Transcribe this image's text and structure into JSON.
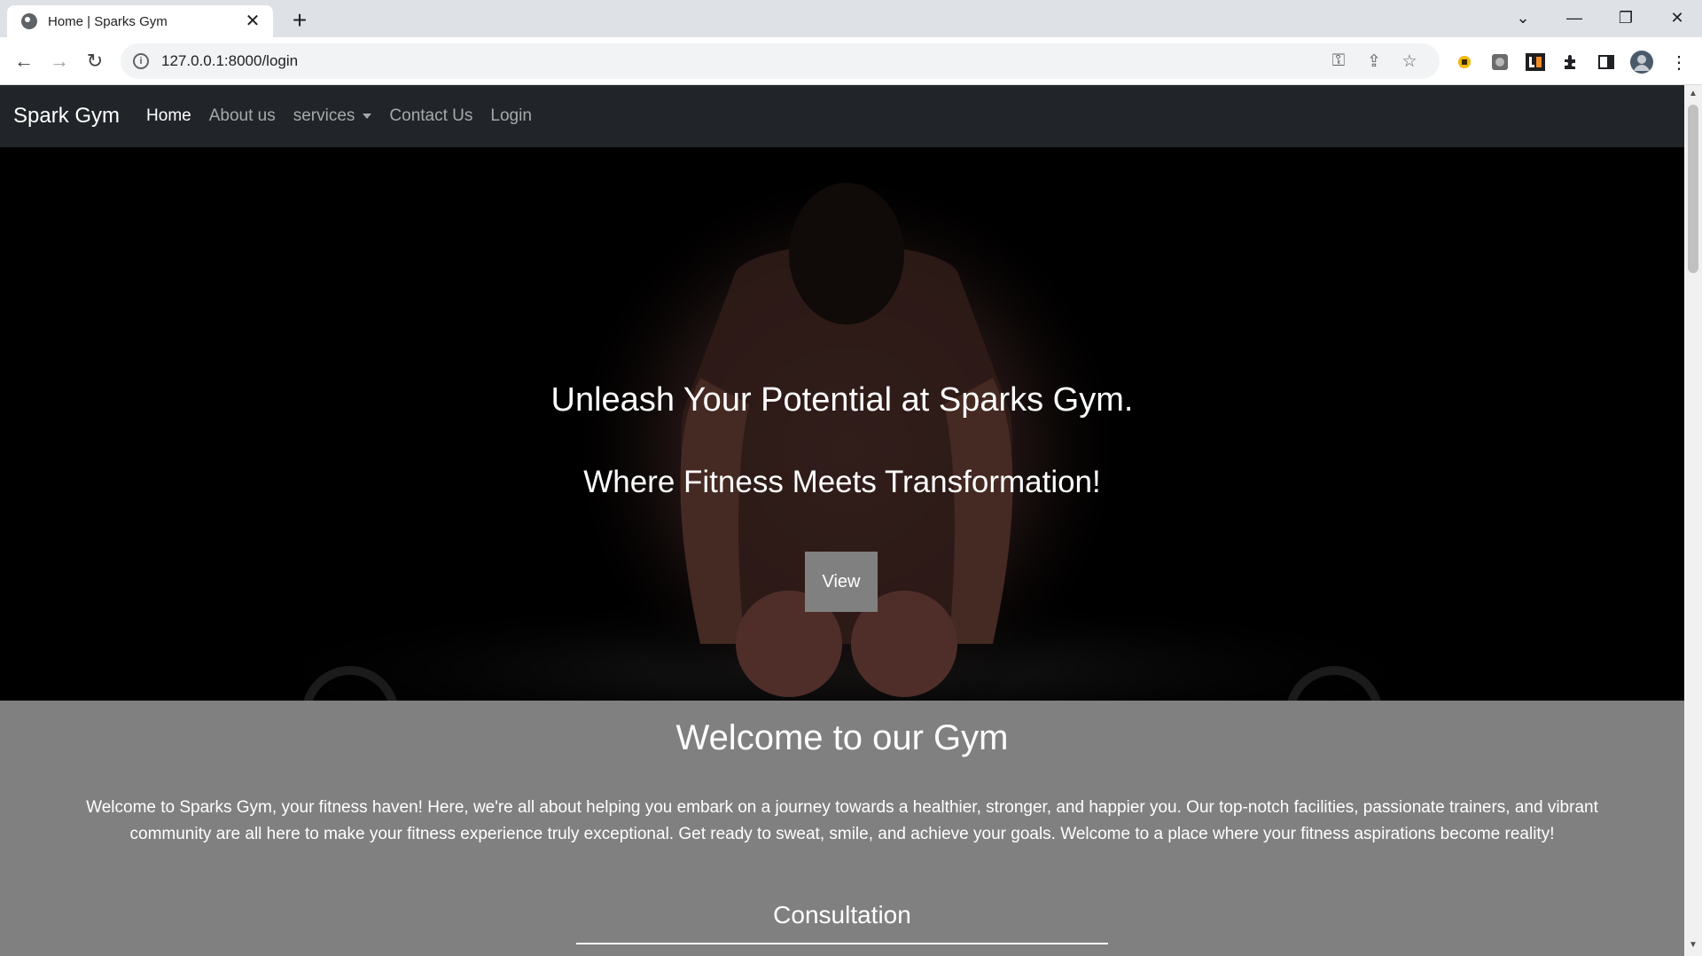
{
  "browser": {
    "tab_title": "Home | Sparks Gym",
    "tab_close": "✕",
    "new_tab": "+",
    "url": "127.0.0.1:8000/login",
    "window_controls": {
      "tab_search": "⌄",
      "minimize": "—",
      "restore": "❐",
      "close": "✕"
    },
    "nav": {
      "back": "←",
      "forward": "→",
      "reload": "↻"
    },
    "omnibox_icons": {
      "key": "⚿",
      "share": "⇪",
      "star": "☆"
    },
    "extensions": [
      "extension-1",
      "extension-2",
      "extension-3",
      "puzzle-icon",
      "sidepanel-icon",
      "profile-avatar",
      "menu-icon"
    ]
  },
  "site": {
    "brand": "Spark Gym",
    "nav": {
      "home": "Home",
      "about": "About us",
      "services": "services",
      "contact": "Contact Us",
      "login": "Login"
    },
    "hero": {
      "title": "Unleash Your Potential at Sparks Gym.",
      "subtitle": "Where Fitness Meets Transformation!",
      "button": "View"
    },
    "welcome": {
      "title": "Welcome to our Gym",
      "text": "Welcome to Sparks Gym, your fitness haven! Here, we're all about helping you embark on a journey towards a healthier, stronger, and happier you. Our top-notch facilities, passionate trainers, and vibrant community are all here to make your fitness experience truly exceptional. Get ready to sweat, smile, and achieve your goals. Welcome to a place where your fitness aspirations become reality!"
    },
    "consultation": {
      "title": "Consultation"
    }
  },
  "colors": {
    "navbar": "#212529",
    "page_bg": "#808080",
    "hero_bg": "#000000",
    "button_bg": "#808080"
  }
}
